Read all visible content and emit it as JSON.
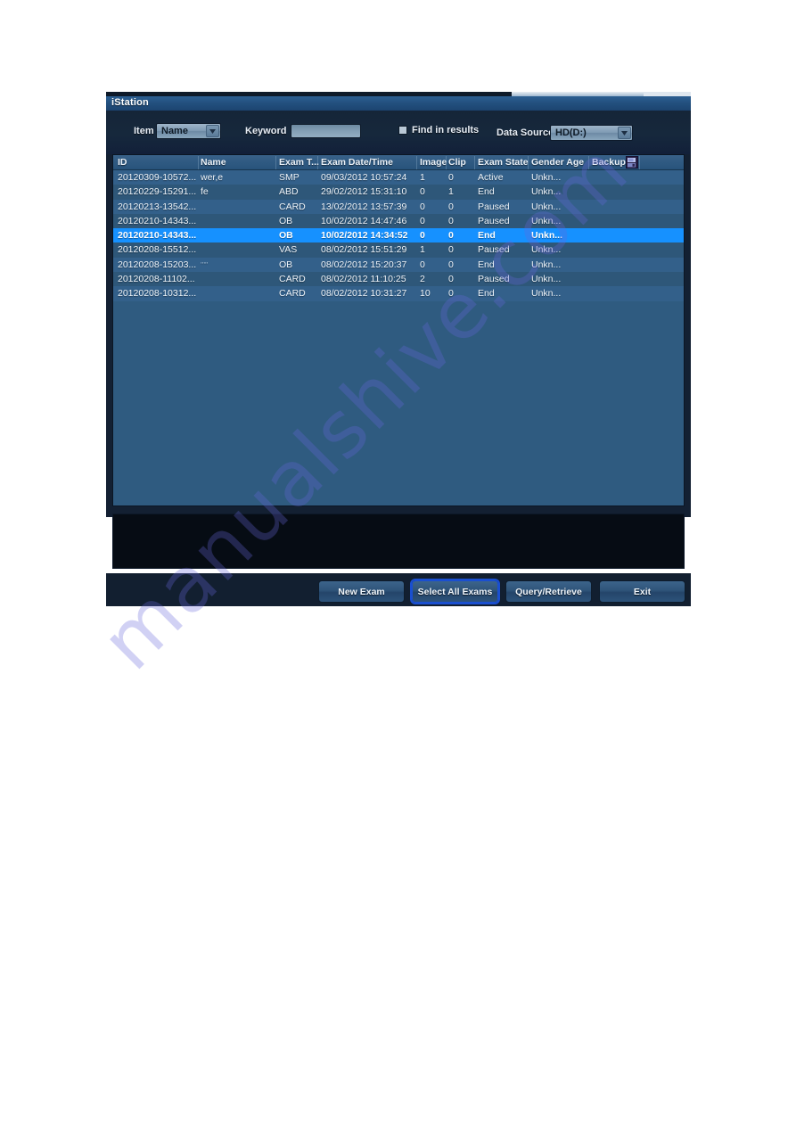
{
  "window": {
    "title": "iStation"
  },
  "toolbar": {
    "item_label": "Item",
    "item_value": "Name",
    "keyword_label": "Keyword",
    "keyword_value": "",
    "keyword_placeholder": "",
    "find_in_results_label": "Find in results",
    "find_in_results_checked": false,
    "data_source_label": "Data Source",
    "data_source_value": "HD(D:)"
  },
  "table": {
    "columns": [
      "ID",
      "Name",
      "Exam T...",
      "Exam Date/Time",
      "Image",
      "Clip",
      "Exam State",
      "Gender Age",
      "Backup"
    ],
    "backup_icon": "floppy-disk-icon",
    "rows": [
      {
        "id": "20120309-10572...",
        "name": "wer,e",
        "exam_type": "SMP",
        "datetime": "09/03/2012 10:57:24",
        "image": "1",
        "clip": "0",
        "state": "Active",
        "gender_age": "Unkn...",
        "backup": "",
        "selected": false
      },
      {
        "id": "20120229-15291...",
        "name": "fe",
        "exam_type": "ABD",
        "datetime": "29/02/2012 15:31:10",
        "image": "0",
        "clip": "1",
        "state": "End",
        "gender_age": "Unkn...",
        "backup": "",
        "selected": false
      },
      {
        "id": "20120213-13542...",
        "name": "",
        "exam_type": "CARD",
        "datetime": "13/02/2012 13:57:39",
        "image": "0",
        "clip": "0",
        "state": "Paused",
        "gender_age": "Unkn...",
        "backup": "",
        "selected": false
      },
      {
        "id": "20120210-14343...",
        "name": "",
        "exam_type": "OB",
        "datetime": "10/02/2012 14:47:46",
        "image": "0",
        "clip": "0",
        "state": "Paused",
        "gender_age": "Unkn...",
        "backup": "",
        "selected": false
      },
      {
        "id": "20120210-14343...",
        "name": "",
        "exam_type": "OB",
        "datetime": "10/02/2012 14:34:52",
        "image": "0",
        "clip": "0",
        "state": "End",
        "gender_age": "Unkn...",
        "backup": "",
        "selected": true
      },
      {
        "id": "20120208-15512...",
        "name": "",
        "exam_type": "VAS",
        "datetime": "08/02/2012 15:51:29",
        "image": "1",
        "clip": "0",
        "state": "Paused",
        "gender_age": "Unkn...",
        "backup": "",
        "selected": false
      },
      {
        "id": "20120208-15203...",
        "name": ",,,,,",
        "exam_type": "OB",
        "datetime": "08/02/2012 15:20:37",
        "image": "0",
        "clip": "0",
        "state": "End",
        "gender_age": "Unkn...",
        "backup": "",
        "selected": false
      },
      {
        "id": "20120208-11102...",
        "name": "",
        "exam_type": "CARD",
        "datetime": "08/02/2012 11:10:25",
        "image": "2",
        "clip": "0",
        "state": "Paused",
        "gender_age": "Unkn...",
        "backup": "",
        "selected": false
      },
      {
        "id": "20120208-10312...",
        "name": "",
        "exam_type": "CARD",
        "datetime": "08/02/2012 10:31:27",
        "image": "10",
        "clip": "0",
        "state": "End",
        "gender_age": "Unkn...",
        "backup": "",
        "selected": false
      }
    ]
  },
  "footer": {
    "buttons": [
      {
        "label": "New Exam",
        "focused": false
      },
      {
        "label": "Select All Exams",
        "focused": true
      },
      {
        "label": "Query/Retrieve",
        "focused": false
      },
      {
        "label": "Exit",
        "focused": false
      }
    ]
  },
  "watermark": {
    "text": "manualshive.com"
  },
  "colors": {
    "accent_selected_row": "#1691ff",
    "panel_background": "#132032",
    "list_background": "#2f5b80",
    "title_bar": "#23517f",
    "preview_background": "#060c14"
  }
}
